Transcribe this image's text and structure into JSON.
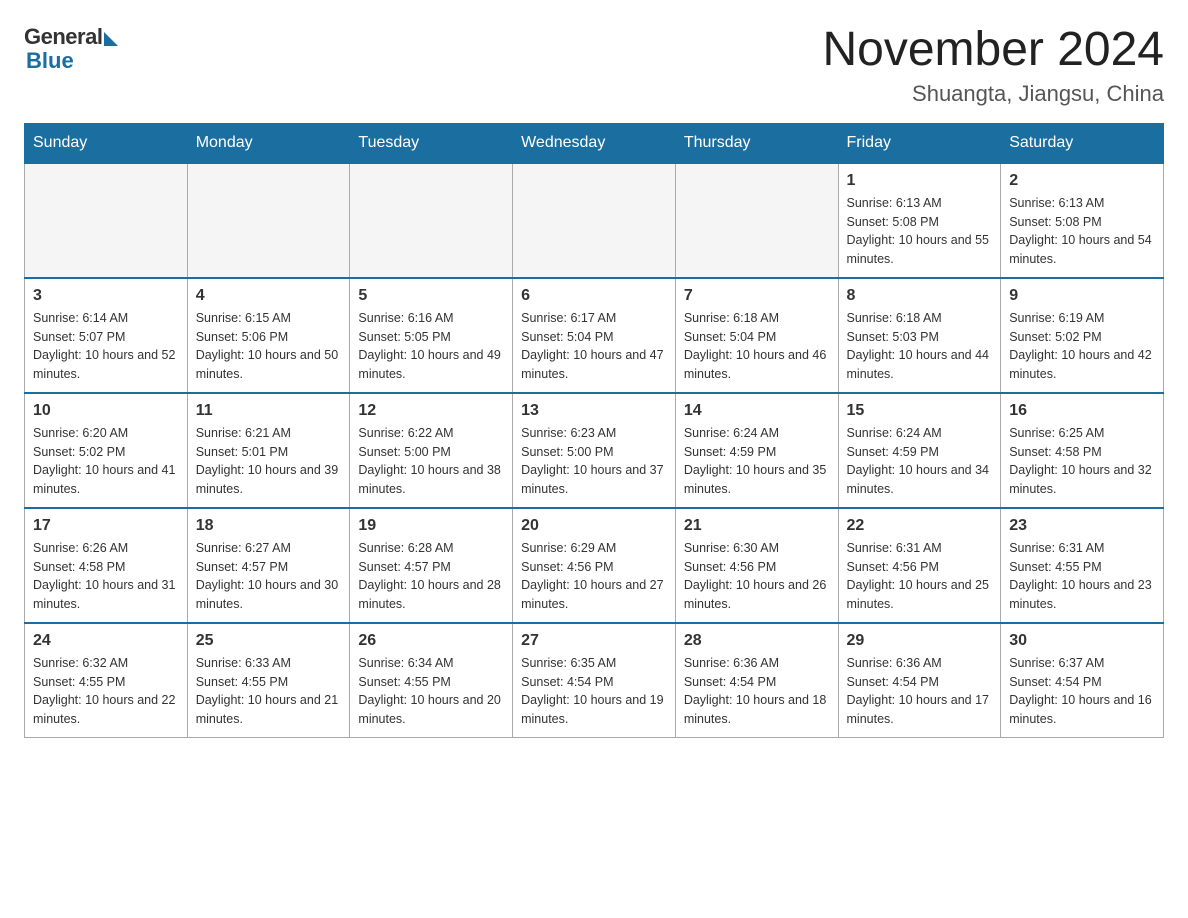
{
  "logo": {
    "general": "General",
    "blue": "Blue"
  },
  "title": "November 2024",
  "location": "Shuangta, Jiangsu, China",
  "weekdays": [
    "Sunday",
    "Monday",
    "Tuesday",
    "Wednesday",
    "Thursday",
    "Friday",
    "Saturday"
  ],
  "weeks": [
    [
      {
        "day": "",
        "info": ""
      },
      {
        "day": "",
        "info": ""
      },
      {
        "day": "",
        "info": ""
      },
      {
        "day": "",
        "info": ""
      },
      {
        "day": "",
        "info": ""
      },
      {
        "day": "1",
        "info": "Sunrise: 6:13 AM\nSunset: 5:08 PM\nDaylight: 10 hours and 55 minutes."
      },
      {
        "day": "2",
        "info": "Sunrise: 6:13 AM\nSunset: 5:08 PM\nDaylight: 10 hours and 54 minutes."
      }
    ],
    [
      {
        "day": "3",
        "info": "Sunrise: 6:14 AM\nSunset: 5:07 PM\nDaylight: 10 hours and 52 minutes."
      },
      {
        "day": "4",
        "info": "Sunrise: 6:15 AM\nSunset: 5:06 PM\nDaylight: 10 hours and 50 minutes."
      },
      {
        "day": "5",
        "info": "Sunrise: 6:16 AM\nSunset: 5:05 PM\nDaylight: 10 hours and 49 minutes."
      },
      {
        "day": "6",
        "info": "Sunrise: 6:17 AM\nSunset: 5:04 PM\nDaylight: 10 hours and 47 minutes."
      },
      {
        "day": "7",
        "info": "Sunrise: 6:18 AM\nSunset: 5:04 PM\nDaylight: 10 hours and 46 minutes."
      },
      {
        "day": "8",
        "info": "Sunrise: 6:18 AM\nSunset: 5:03 PM\nDaylight: 10 hours and 44 minutes."
      },
      {
        "day": "9",
        "info": "Sunrise: 6:19 AM\nSunset: 5:02 PM\nDaylight: 10 hours and 42 minutes."
      }
    ],
    [
      {
        "day": "10",
        "info": "Sunrise: 6:20 AM\nSunset: 5:02 PM\nDaylight: 10 hours and 41 minutes."
      },
      {
        "day": "11",
        "info": "Sunrise: 6:21 AM\nSunset: 5:01 PM\nDaylight: 10 hours and 39 minutes."
      },
      {
        "day": "12",
        "info": "Sunrise: 6:22 AM\nSunset: 5:00 PM\nDaylight: 10 hours and 38 minutes."
      },
      {
        "day": "13",
        "info": "Sunrise: 6:23 AM\nSunset: 5:00 PM\nDaylight: 10 hours and 37 minutes."
      },
      {
        "day": "14",
        "info": "Sunrise: 6:24 AM\nSunset: 4:59 PM\nDaylight: 10 hours and 35 minutes."
      },
      {
        "day": "15",
        "info": "Sunrise: 6:24 AM\nSunset: 4:59 PM\nDaylight: 10 hours and 34 minutes."
      },
      {
        "day": "16",
        "info": "Sunrise: 6:25 AM\nSunset: 4:58 PM\nDaylight: 10 hours and 32 minutes."
      }
    ],
    [
      {
        "day": "17",
        "info": "Sunrise: 6:26 AM\nSunset: 4:58 PM\nDaylight: 10 hours and 31 minutes."
      },
      {
        "day": "18",
        "info": "Sunrise: 6:27 AM\nSunset: 4:57 PM\nDaylight: 10 hours and 30 minutes."
      },
      {
        "day": "19",
        "info": "Sunrise: 6:28 AM\nSunset: 4:57 PM\nDaylight: 10 hours and 28 minutes."
      },
      {
        "day": "20",
        "info": "Sunrise: 6:29 AM\nSunset: 4:56 PM\nDaylight: 10 hours and 27 minutes."
      },
      {
        "day": "21",
        "info": "Sunrise: 6:30 AM\nSunset: 4:56 PM\nDaylight: 10 hours and 26 minutes."
      },
      {
        "day": "22",
        "info": "Sunrise: 6:31 AM\nSunset: 4:56 PM\nDaylight: 10 hours and 25 minutes."
      },
      {
        "day": "23",
        "info": "Sunrise: 6:31 AM\nSunset: 4:55 PM\nDaylight: 10 hours and 23 minutes."
      }
    ],
    [
      {
        "day": "24",
        "info": "Sunrise: 6:32 AM\nSunset: 4:55 PM\nDaylight: 10 hours and 22 minutes."
      },
      {
        "day": "25",
        "info": "Sunrise: 6:33 AM\nSunset: 4:55 PM\nDaylight: 10 hours and 21 minutes."
      },
      {
        "day": "26",
        "info": "Sunrise: 6:34 AM\nSunset: 4:55 PM\nDaylight: 10 hours and 20 minutes."
      },
      {
        "day": "27",
        "info": "Sunrise: 6:35 AM\nSunset: 4:54 PM\nDaylight: 10 hours and 19 minutes."
      },
      {
        "day": "28",
        "info": "Sunrise: 6:36 AM\nSunset: 4:54 PM\nDaylight: 10 hours and 18 minutes."
      },
      {
        "day": "29",
        "info": "Sunrise: 6:36 AM\nSunset: 4:54 PM\nDaylight: 10 hours and 17 minutes."
      },
      {
        "day": "30",
        "info": "Sunrise: 6:37 AM\nSunset: 4:54 PM\nDaylight: 10 hours and 16 minutes."
      }
    ]
  ]
}
